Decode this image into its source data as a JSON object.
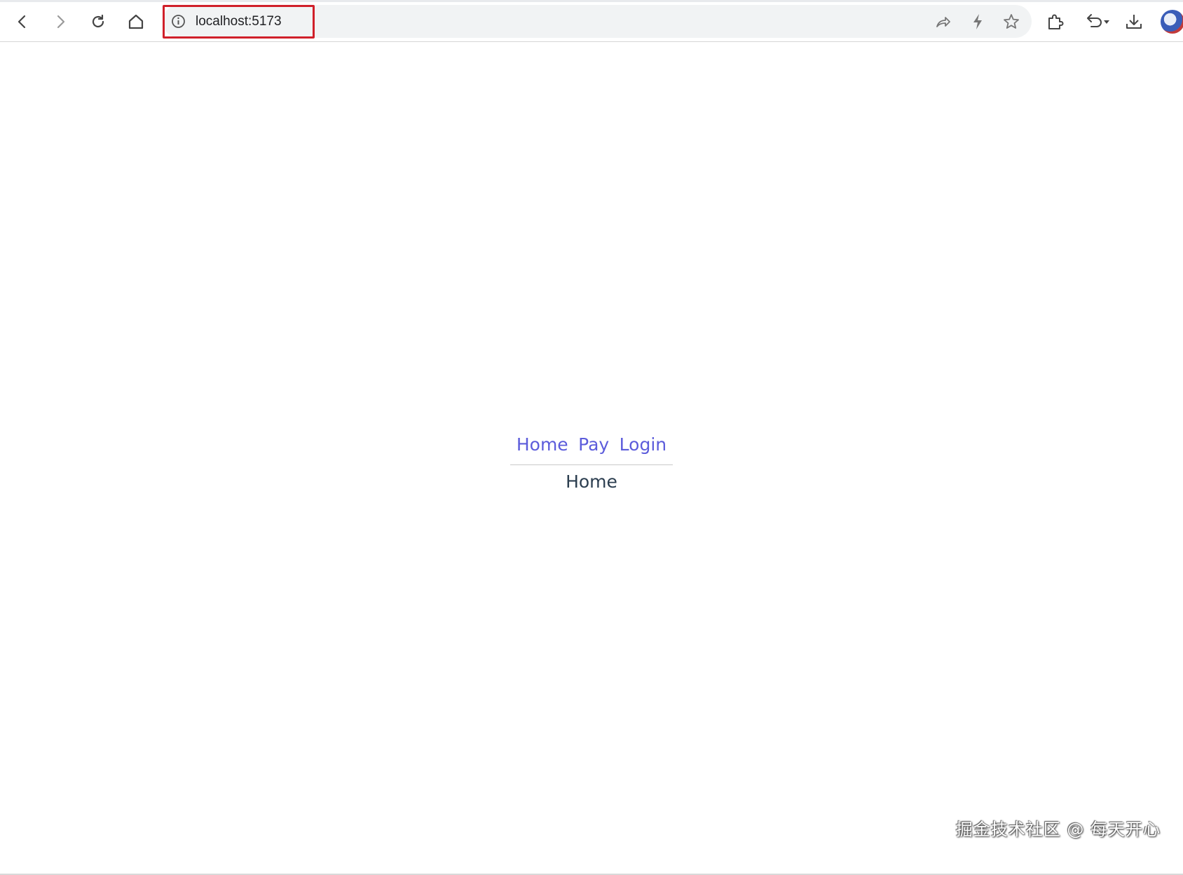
{
  "browser": {
    "url": "localhost:5173",
    "icons": {
      "back": "back-arrow-icon",
      "forward": "forward-arrow-icon",
      "reload": "reload-icon",
      "home": "home-icon",
      "site_info": "info-icon",
      "share": "share-icon",
      "lightning": "lightning-icon",
      "bookmark": "star-icon",
      "extensions": "puzzle-icon",
      "undo": "undo-icon",
      "download": "download-icon",
      "profile": "avatar"
    },
    "highlight_color": "#d0202a"
  },
  "app": {
    "nav": {
      "home_label": "Home",
      "pay_label": "Pay",
      "login_label": "Login"
    },
    "view_text": "Home",
    "link_color": "#5c5cdb",
    "text_color": "#2c3e50"
  },
  "watermark": "掘金技术社区 @ 每天开心"
}
